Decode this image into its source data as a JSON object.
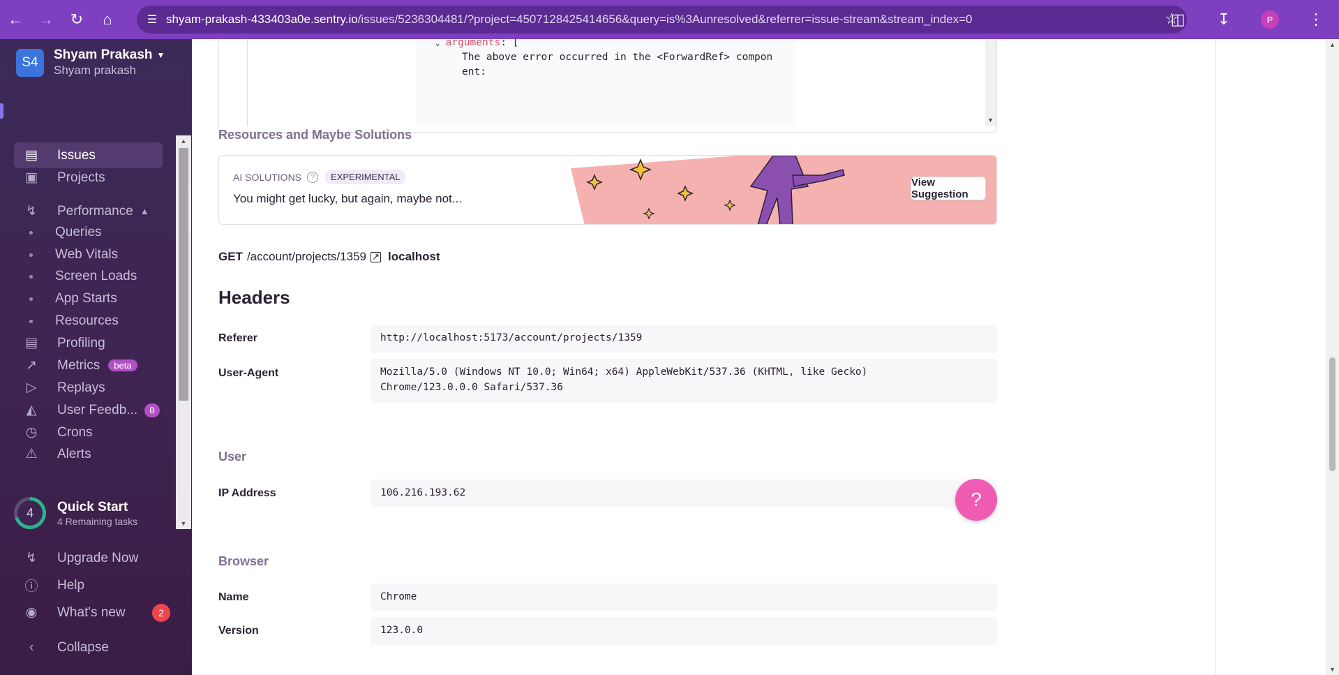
{
  "browser": {
    "url_host": "shyam-prakash-433403a0e.sentry.io",
    "url_rest": "/issues/5236304481/?project=4507128425414656&query=is%3Aunresolved&referrer=issue-stream&stream_index=0",
    "profile_initial": "P"
  },
  "sidebar": {
    "org_initials": "S4",
    "org_name": "Shyam Prakash",
    "org_user": "Shyam prakash",
    "items": {
      "issues": "Issues",
      "projects": "Projects",
      "performance": "Performance",
      "queries": "Queries",
      "web_vitals": "Web Vitals",
      "screen_loads": "Screen Loads",
      "app_starts": "App Starts",
      "resources": "Resources",
      "profiling": "Profiling",
      "metrics": "Metrics",
      "metrics_badge": "beta",
      "replays": "Replays",
      "user_feedback": "User Feedb...",
      "user_feedback_badge": "B",
      "crons": "Crons",
      "alerts": "Alerts"
    },
    "quick_start": {
      "count": "4",
      "title": "Quick Start",
      "subtitle": "4 Remaining tasks",
      "progress": 0.7
    },
    "bottom": {
      "upgrade": "Upgrade Now",
      "help": "Help",
      "whats_new": "What's new",
      "whats_new_count": "2",
      "collapse": "Collapse"
    }
  },
  "code": {
    "key": "arguments",
    "bracket": ": [",
    "line1": "The above error occurred in the <ForwardRef> compon",
    "line2": "ent:"
  },
  "resources": {
    "title": "Resources and Maybe Solutions",
    "ai_label": "AI SOLUTIONS",
    "ai_badge": "EXPERIMENTAL",
    "ai_text": "You might get lucky, but again, maybe not...",
    "button": "View Suggestion"
  },
  "request": {
    "method": "GET",
    "path": "/account/projects/1359",
    "host": "localhost"
  },
  "headers": {
    "title": "Headers",
    "referer_key": "Referer",
    "referer_val": "http://localhost:5173/account/projects/1359",
    "ua_key": "User-Agent",
    "ua_val_1": "Mozilla/5.0 (Windows NT 10.0; Win64; x64) AppleWebKit/537.36 (KHTML, like Gecko)",
    "ua_val_2": "Chrome/123.0.0.0 Safari/537.36"
  },
  "user": {
    "title": "User",
    "ip_key": "IP Address",
    "ip_val": "106.216.193.62"
  },
  "browser_ctx": {
    "title": "Browser",
    "name_key": "Name",
    "name_val": "Chrome",
    "version_key": "Version",
    "version_val": "123.0.0"
  },
  "help_fab": "?",
  "colors": {
    "chrome": "#7e3fc0",
    "sidebar": "#3f2452",
    "accent": "#8a72e8",
    "fab": "#f05cb3",
    "ai_banner": "#f5b1b0"
  }
}
